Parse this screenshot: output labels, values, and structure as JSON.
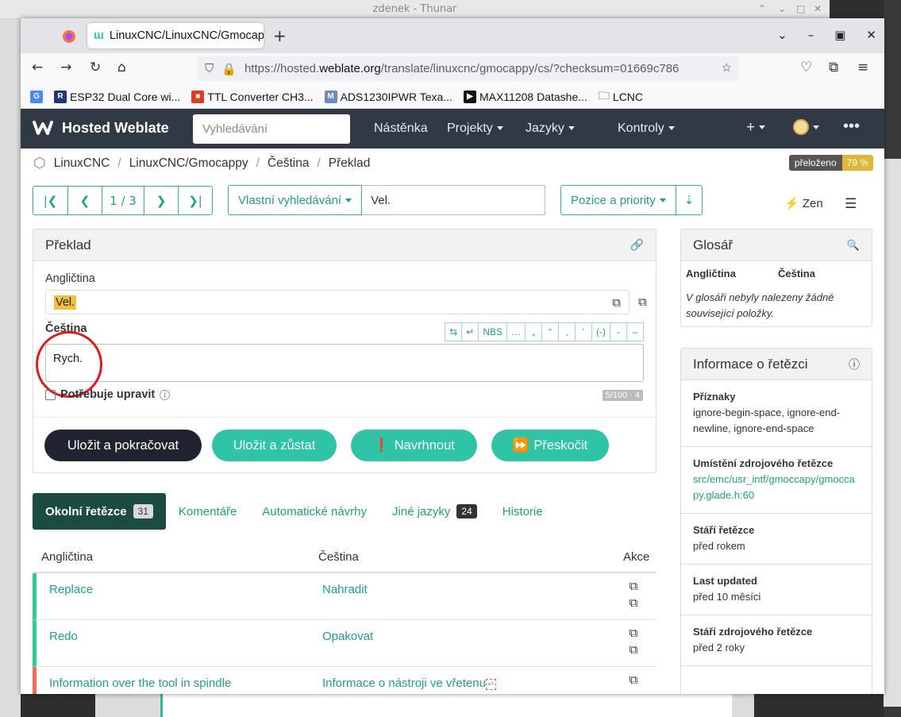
{
  "desktop": {
    "thunar_title": "zdenek - Thunar"
  },
  "browser": {
    "tab_title": "LinuxCNC/LinuxCNC/Gmocappy",
    "url_prefix": "https://hosted.",
    "url_domain": "weblate.org",
    "url_path": "/translate/linuxcnc/gmocappy/cs/?checksum=01669c786",
    "bookmarks": [
      {
        "label": "ESP32 Dual Core wi..."
      },
      {
        "label": "TTL Converter CH3..."
      },
      {
        "label": "ADS1230IPWR Texa..."
      },
      {
        "label": "MAX11208 Datashe..."
      },
      {
        "label": "LCNC"
      }
    ]
  },
  "weblate": {
    "brand": "Hosted Weblate",
    "search_placeholder": "Vyhledávání",
    "menu": [
      "Nástěnka",
      "Projekty",
      "Jazyky",
      "Kontroly"
    ],
    "breadcrumb": [
      "LinuxCNC",
      "LinuxCNC/Gmocappy",
      "Čeština",
      "Překlad"
    ],
    "progress_label": "přeloženo",
    "progress_value": "79 %",
    "pager": "1 / 3",
    "search_mode": "Vlastní vyhledávání",
    "search_query": "Vel.",
    "sort_label": "Pozice a priority",
    "zen": "Zen"
  },
  "translate": {
    "title": "Překlad",
    "source_lang": "Angličtina",
    "source_text": "Vel.",
    "target_lang": "Čeština",
    "target_text": "Rych.",
    "special_chars": [
      "⇆",
      "↵",
      "NBS",
      "…",
      "„",
      "“",
      ",",
      "‘",
      "(-)",
      "-",
      "–"
    ],
    "needs_edit": "Potřebuje upravit",
    "char_count": "5/100 · 4",
    "buttons": {
      "save_continue": "Uložit a pokračovat",
      "save_stay": "Uložit a zůstat",
      "suggest": "Navrhnout",
      "skip": "Přeskočit"
    }
  },
  "tabs": [
    {
      "label": "Okolní řetězce",
      "badge": "31"
    },
    {
      "label": "Komentáře"
    },
    {
      "label": "Automatické návrhy"
    },
    {
      "label": "Jiné jazyky",
      "badge": "24"
    },
    {
      "label": "Historie"
    }
  ],
  "table": {
    "headers": [
      "Angličtina",
      "Čeština",
      "Akce"
    ],
    "rows": [
      {
        "source": "Replace",
        "target": "Nahradit",
        "status": "translated"
      },
      {
        "source": "Redo",
        "target": "Opakovat",
        "status": "translated"
      },
      {
        "source": "Information over the tool in spindle",
        "target": "Informace o nástroji ve vřetenu",
        "status": "needs-attention"
      }
    ]
  },
  "glossary": {
    "title": "Glosář",
    "col_source": "Angličtina",
    "col_target": "Čeština",
    "empty": "V glosáři nebyly nalezeny žádné související položky."
  },
  "string_info": {
    "title": "Informace o řetězci",
    "items": [
      {
        "key": "Příznaky",
        "value": "ignore-begin-space, ignore-end-newline, ignore-end-space"
      },
      {
        "key": "Umístění zdrojového řetězce",
        "value": "src/emc/usr_intf/gmoccapy/gmoccapy.glade.h:60"
      },
      {
        "key": "Stáří řetězce",
        "value": "před rokem"
      },
      {
        "key": "Last updated",
        "value": "před 10 měsíci"
      },
      {
        "key": "Stáří zdrojového řetězce",
        "value": "před 2 roky"
      }
    ]
  },
  "colors": {
    "accent": "#2eb89d",
    "header": "#313a44",
    "dark_button": "#1e2530",
    "active_tab": "#1b4b41",
    "progress": "#e0b63a"
  }
}
